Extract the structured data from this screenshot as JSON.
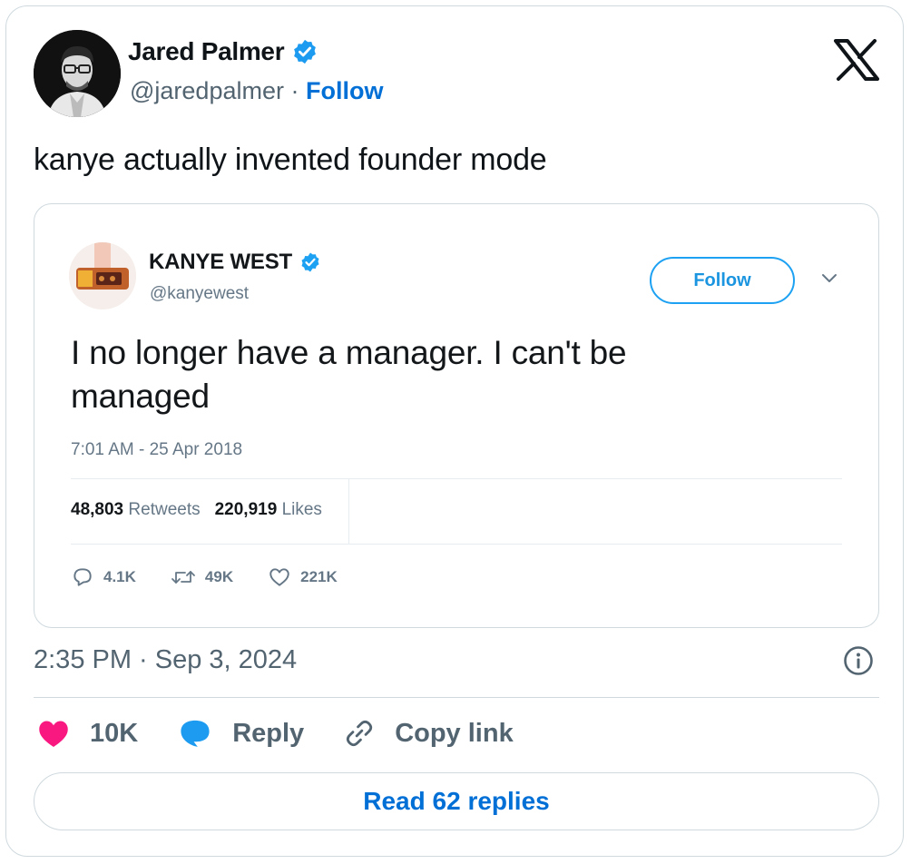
{
  "author": {
    "name": "Jared Palmer",
    "handle": "@jaredpalmer",
    "separator": "·",
    "follow_label": "Follow"
  },
  "tweet": {
    "text": "kanye actually invented founder mode",
    "timestamp": "2:35 PM · Sep 3, 2024"
  },
  "quoted": {
    "name": "KANYE WEST",
    "handle": "@kanyewest",
    "follow_label": "Follow",
    "text": "I no longer have a manager. I can't be managed",
    "time": "7:01 AM - 25 Apr 2018",
    "retweets_count": "48,803",
    "retweets_label": "Retweets",
    "likes_count": "220,919",
    "likes_label": "Likes",
    "actions": {
      "replies": "4.1K",
      "retweets": "49K",
      "likes": "221K"
    }
  },
  "actions": {
    "likes": "10K",
    "reply_label": "Reply",
    "copy_label": "Copy link"
  },
  "read_replies_label": "Read 62 replies",
  "colors": {
    "accent": "#006fd6",
    "heart": "#f91880",
    "reply_bubble": "#1d9bf0",
    "verified": "#1d9bf0"
  }
}
